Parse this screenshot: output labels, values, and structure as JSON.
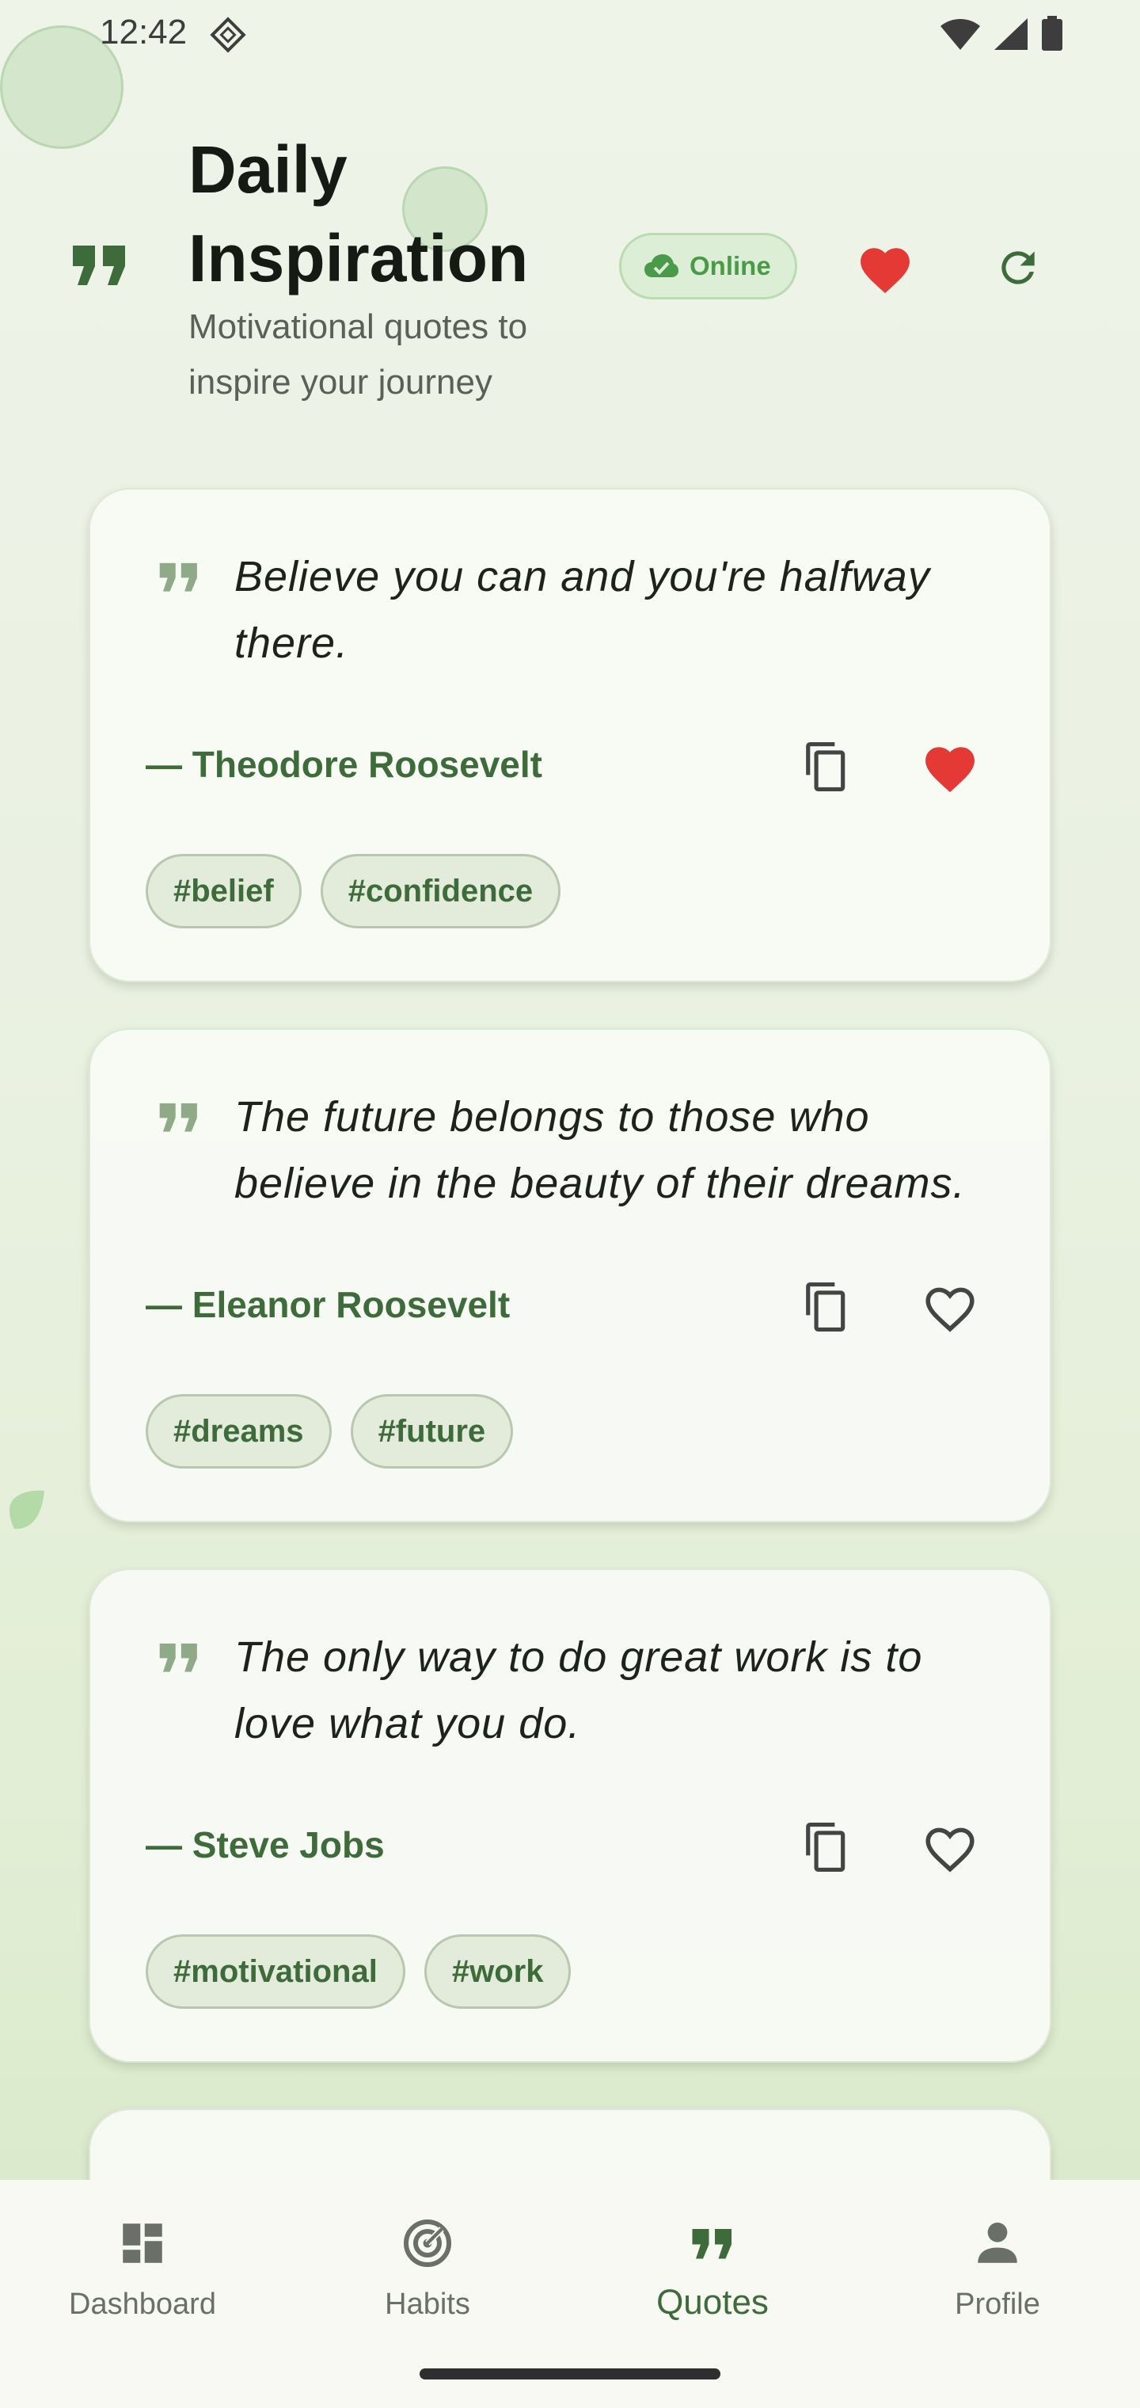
{
  "status_bar": {
    "time": "12:42"
  },
  "header": {
    "title": "Daily Inspiration",
    "subtitle": "Motivational quotes to inspire your journey",
    "online_label": "Online"
  },
  "quotes": [
    {
      "text": "Believe you can and you're halfway there.",
      "author": "— Theodore Roosevelt",
      "tags": [
        "#belief",
        "#confidence"
      ],
      "favorited": true
    },
    {
      "text": "The future belongs to those who believe in the beauty of their dreams.",
      "author": "— Eleanor Roosevelt",
      "tags": [
        "#dreams",
        "#future"
      ],
      "favorited": false
    },
    {
      "text": "The only way to do great work is to love what you do.",
      "author": "— Steve Jobs",
      "tags": [
        "#motivational",
        "#work"
      ],
      "favorited": false
    }
  ],
  "bottom_nav": {
    "items": [
      {
        "label": "Dashboard",
        "icon": "dashboard-icon"
      },
      {
        "label": "Habits",
        "icon": "target-icon"
      },
      {
        "label": "Quotes",
        "icon": "quote-icon"
      },
      {
        "label": "Profile",
        "icon": "person-icon"
      }
    ],
    "active": "Quotes"
  },
  "colors": {
    "accent_green": "#3e6b3a",
    "favorite_red": "#e53935",
    "online_green": "#4a9a49"
  }
}
